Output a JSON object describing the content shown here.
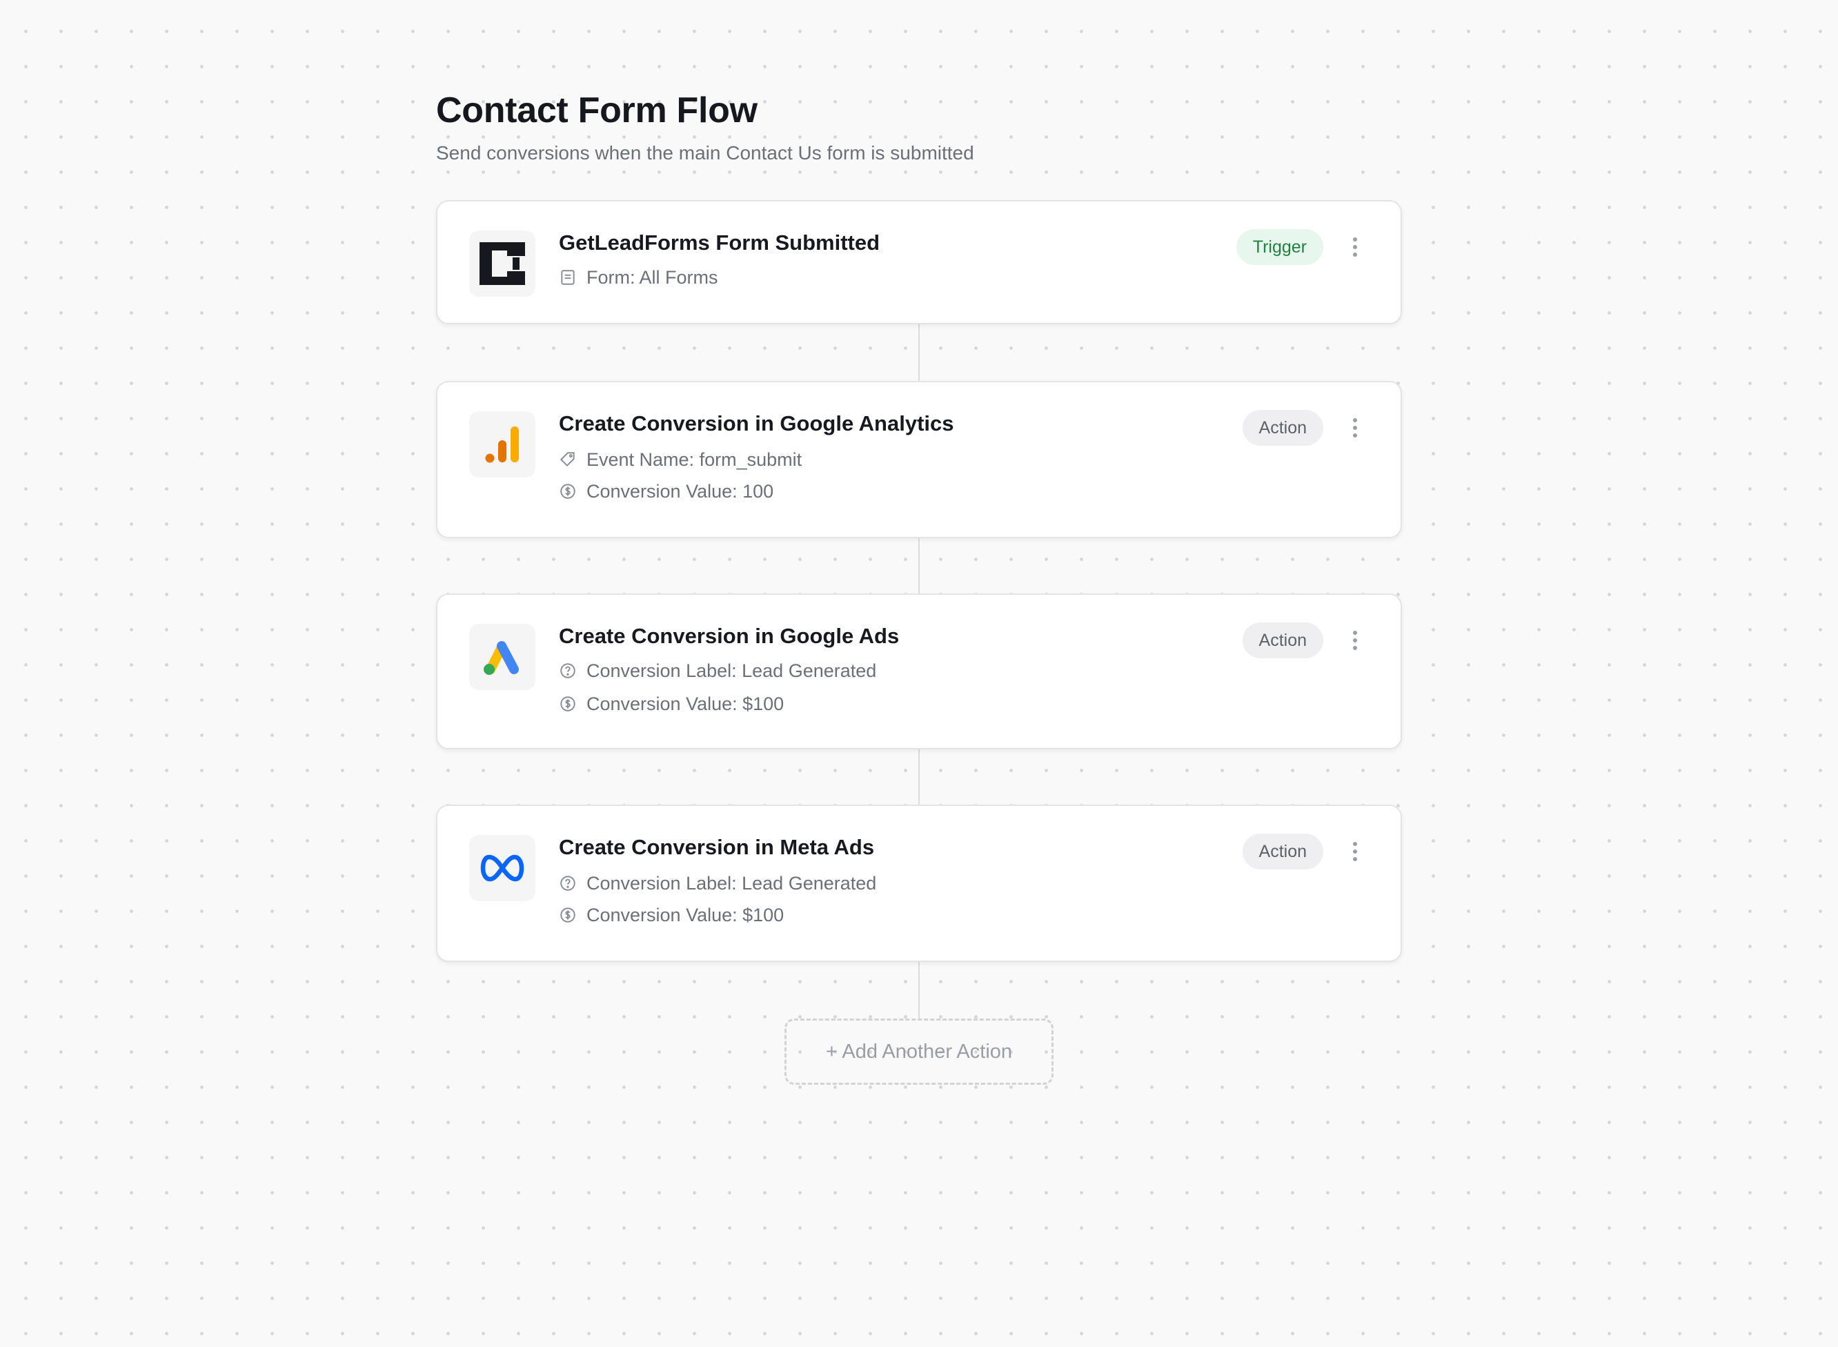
{
  "flow": {
    "title": "Contact Form Flow",
    "subtitle": "Send conversions when the main Contact Us form is submitted"
  },
  "colors": {
    "trigger_badge_bg": "#e8f7ee",
    "trigger_badge_text": "#238044",
    "action_badge_bg": "#efeff1",
    "action_badge_text": "#5d6168",
    "google_analytics_orange": "#e37400",
    "google_analytics_yellow": "#f9ab00",
    "google_ads_blue": "#4285f4",
    "google_ads_yellow": "#fbbc04",
    "google_ads_green": "#34a853",
    "meta_blue": "#0866ff"
  },
  "steps": [
    {
      "app": "GetLeadForms",
      "logo_icon": "getleadforms-logo-icon",
      "title": "GetLeadForms Form Submitted",
      "badge": "Trigger",
      "details": [
        {
          "icon": "form-icon",
          "text": "Form: All Forms"
        }
      ]
    },
    {
      "app": "Google Analytics",
      "logo_icon": "google-analytics-logo-icon",
      "title": "Create Conversion in Google Analytics",
      "badge": "Action",
      "details": [
        {
          "icon": "tag-icon",
          "text": "Event Name: form_submit"
        },
        {
          "icon": "dollar-circle-icon",
          "text": "Conversion Value: 100"
        }
      ]
    },
    {
      "app": "Google Ads",
      "logo_icon": "google-ads-logo-icon",
      "title": "Create Conversion in Google Ads",
      "badge": "Action",
      "details": [
        {
          "icon": "question-circle-icon",
          "text": "Conversion Label: Lead Generated"
        },
        {
          "icon": "dollar-circle-icon",
          "text": "Conversion Value: $100"
        }
      ]
    },
    {
      "app": "Meta Ads",
      "logo_icon": "meta-logo-icon",
      "title": "Create Conversion in Meta Ads",
      "badge": "Action",
      "details": [
        {
          "icon": "question-circle-icon",
          "text": "Conversion Label: Lead Generated"
        },
        {
          "icon": "dollar-circle-icon",
          "text": "Conversion Value: $100"
        }
      ]
    }
  ],
  "add_action_label": "+ Add Another Action",
  "menu_icon": "more-vertical-icon"
}
